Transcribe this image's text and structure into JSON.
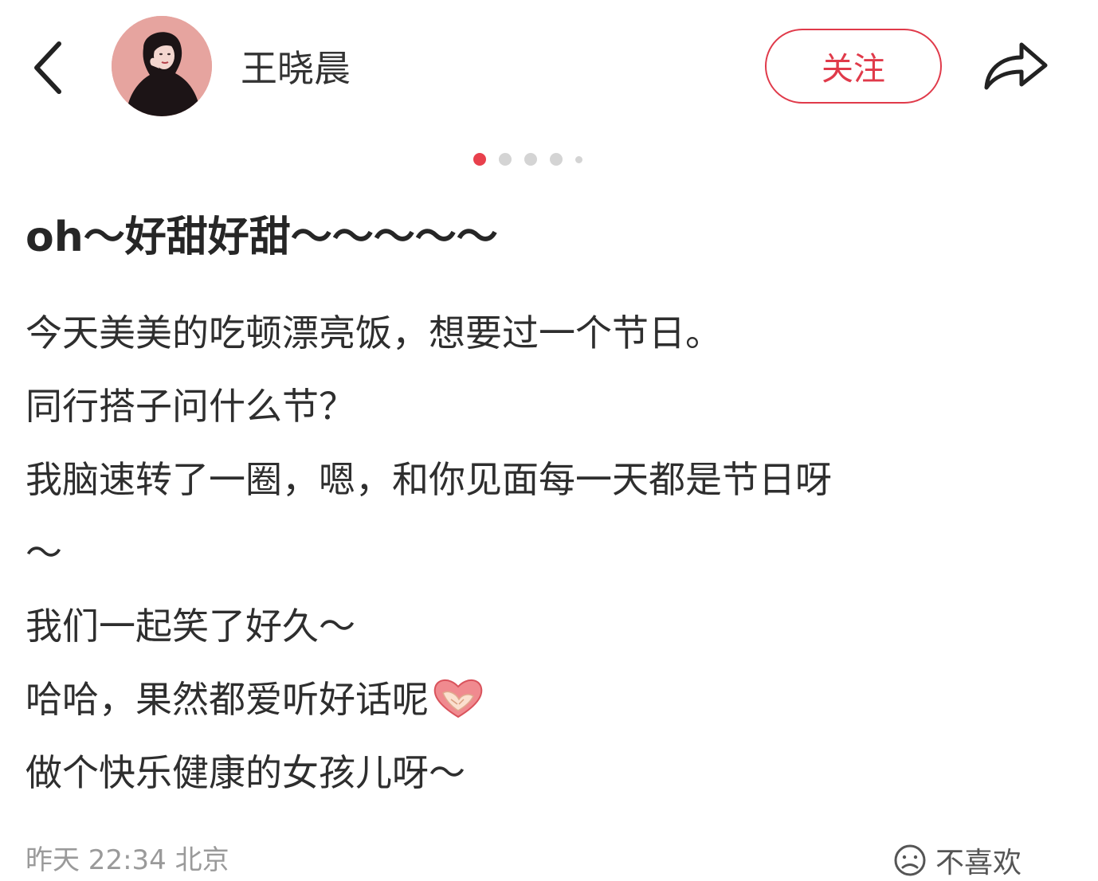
{
  "header": {
    "username": "王晓晨",
    "follow_label": "关注",
    "back_icon": "chevron-left-icon",
    "share_icon": "share-arrow-icon"
  },
  "carousel": {
    "total_dots": 5,
    "active_index": 0
  },
  "post": {
    "title": "oh～好甜好甜～～～～～",
    "lines": [
      "今天美美的吃顿漂亮饭，想要过一个节日。",
      "同行搭子问什么节？",
      "我脑速转了一圈，嗯，和你见面每一天都是节日呀",
      "～",
      "我们一起笑了好久～",
      "哈哈，果然都爱听好话呢",
      "做个快乐健康的女孩儿呀～"
    ],
    "emoji": "heart-hands-icon"
  },
  "footer": {
    "meta": "昨天 22:34 北京",
    "dislike_label": "不喜欢"
  },
  "colors": {
    "accent": "#e03a4a",
    "active_dot": "#e8404c",
    "inactive_dot": "#d4d4d4",
    "text": "#2e2e2e",
    "meta_text": "#9a9a9a"
  }
}
